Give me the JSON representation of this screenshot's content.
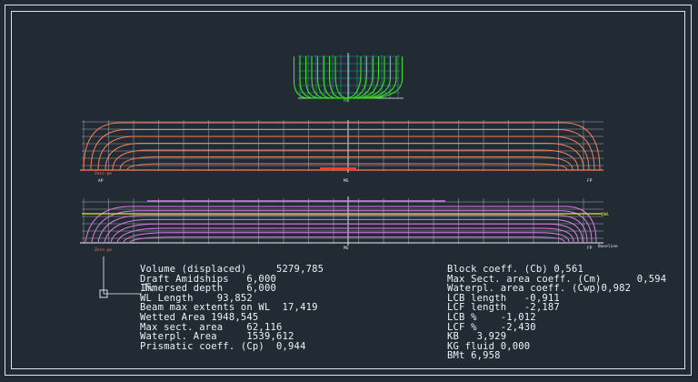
{
  "view": {
    "background": "#222b33",
    "frame_color": "#dfe6ea",
    "grid_color": "#1f9f98",
    "body_plan_color": "#3ee021",
    "profile_color": "#ff7a55",
    "plan_color": "#e07ae8",
    "dwl_color": "#e8e83a"
  },
  "labels": {
    "body_plan_mid": "MS",
    "profile_zero": "Zero pe",
    "profile_ap": "AP",
    "profile_ms": "MS",
    "profile_fp": "FP",
    "plan_zero": "Zero pe",
    "plan_ms": "MS",
    "plan_fp": "FP",
    "plan_baseline": "Baseline",
    "plan_dwl": "DWL"
  },
  "hydrostatics_left": [
    "Volume (displaced)     5279,785",
    "Draft Amidships   6,000",
    "Immersed depth    6,000",
    "WL Length    93,852",
    "Beam max extents on WL  17,419",
    "Wetted Area 1948,545",
    "Max sect. area    62,116",
    "Waterpl. Area     1539,612",
    "Prismatic coeff. (Cp)  0,944"
  ],
  "hydrostatics_right": [
    "Block coeff. (Cb) 0,561",
    "Max Sect. area coeff. (Cm)      0,594",
    "Waterpl. area coeff. (Cwp)0,982",
    "LCB length   -0,911",
    "LCF length   -2,187",
    "LCB %    -1,012",
    "LCF %    -2,430",
    "KB   3,929",
    "KG fluid 0,000",
    "BMt 6,958"
  ]
}
